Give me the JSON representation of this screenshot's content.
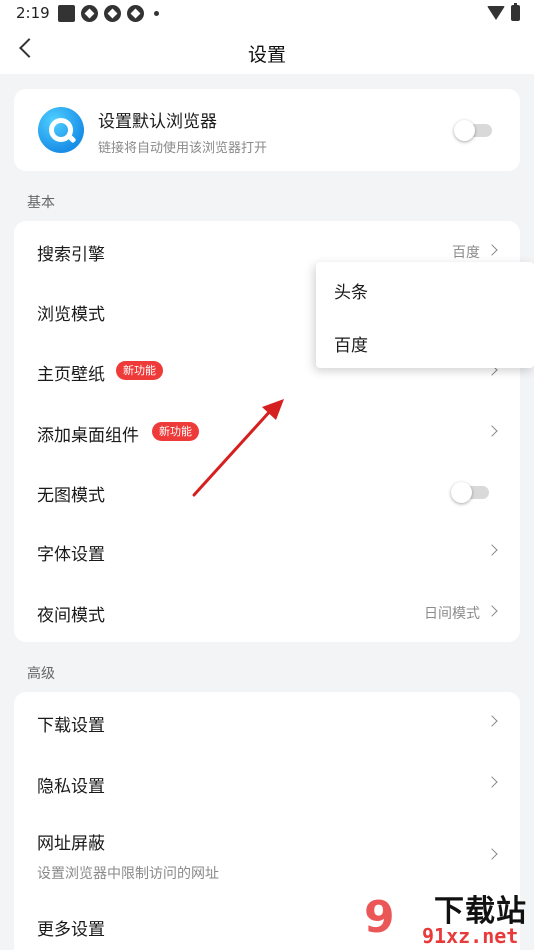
{
  "status_bar": {
    "time": "2:19"
  },
  "header": {
    "title": "设置"
  },
  "default_browser": {
    "title": "设置默认浏览器",
    "subtitle": "链接将自动使用该浏览器打开",
    "enabled": false
  },
  "sections": {
    "basic_label": "基本",
    "advanced_label": "高级"
  },
  "basic_items": {
    "search_engine": {
      "label": "搜索引擎",
      "value": "百度"
    },
    "browse_mode": {
      "label": "浏览模式"
    },
    "wallpaper": {
      "label": "主页壁纸",
      "badge": "新功能"
    },
    "desktop_widget": {
      "label": "添加桌面组件",
      "badge": "新功能"
    },
    "no_image": {
      "label": "无图模式",
      "enabled": false
    },
    "font": {
      "label": "字体设置"
    },
    "night": {
      "label": "夜间模式",
      "value": "日间模式"
    }
  },
  "advanced_items": {
    "download": {
      "label": "下载设置"
    },
    "privacy": {
      "label": "隐私设置"
    },
    "url_block": {
      "label": "网址屏蔽",
      "subtitle": "设置浏览器中限制访问的网址"
    },
    "more": {
      "label": "更多设置"
    }
  },
  "dropdown": {
    "options": [
      "头条",
      "百度"
    ]
  },
  "watermark": {
    "brand": "下载站",
    "url": "91xz.net",
    "logo_text": "9"
  },
  "colors": {
    "accent_red": "#ef3a3a",
    "annotation_arrow": "#d62020",
    "logo_blue": "#1a8fe8"
  }
}
